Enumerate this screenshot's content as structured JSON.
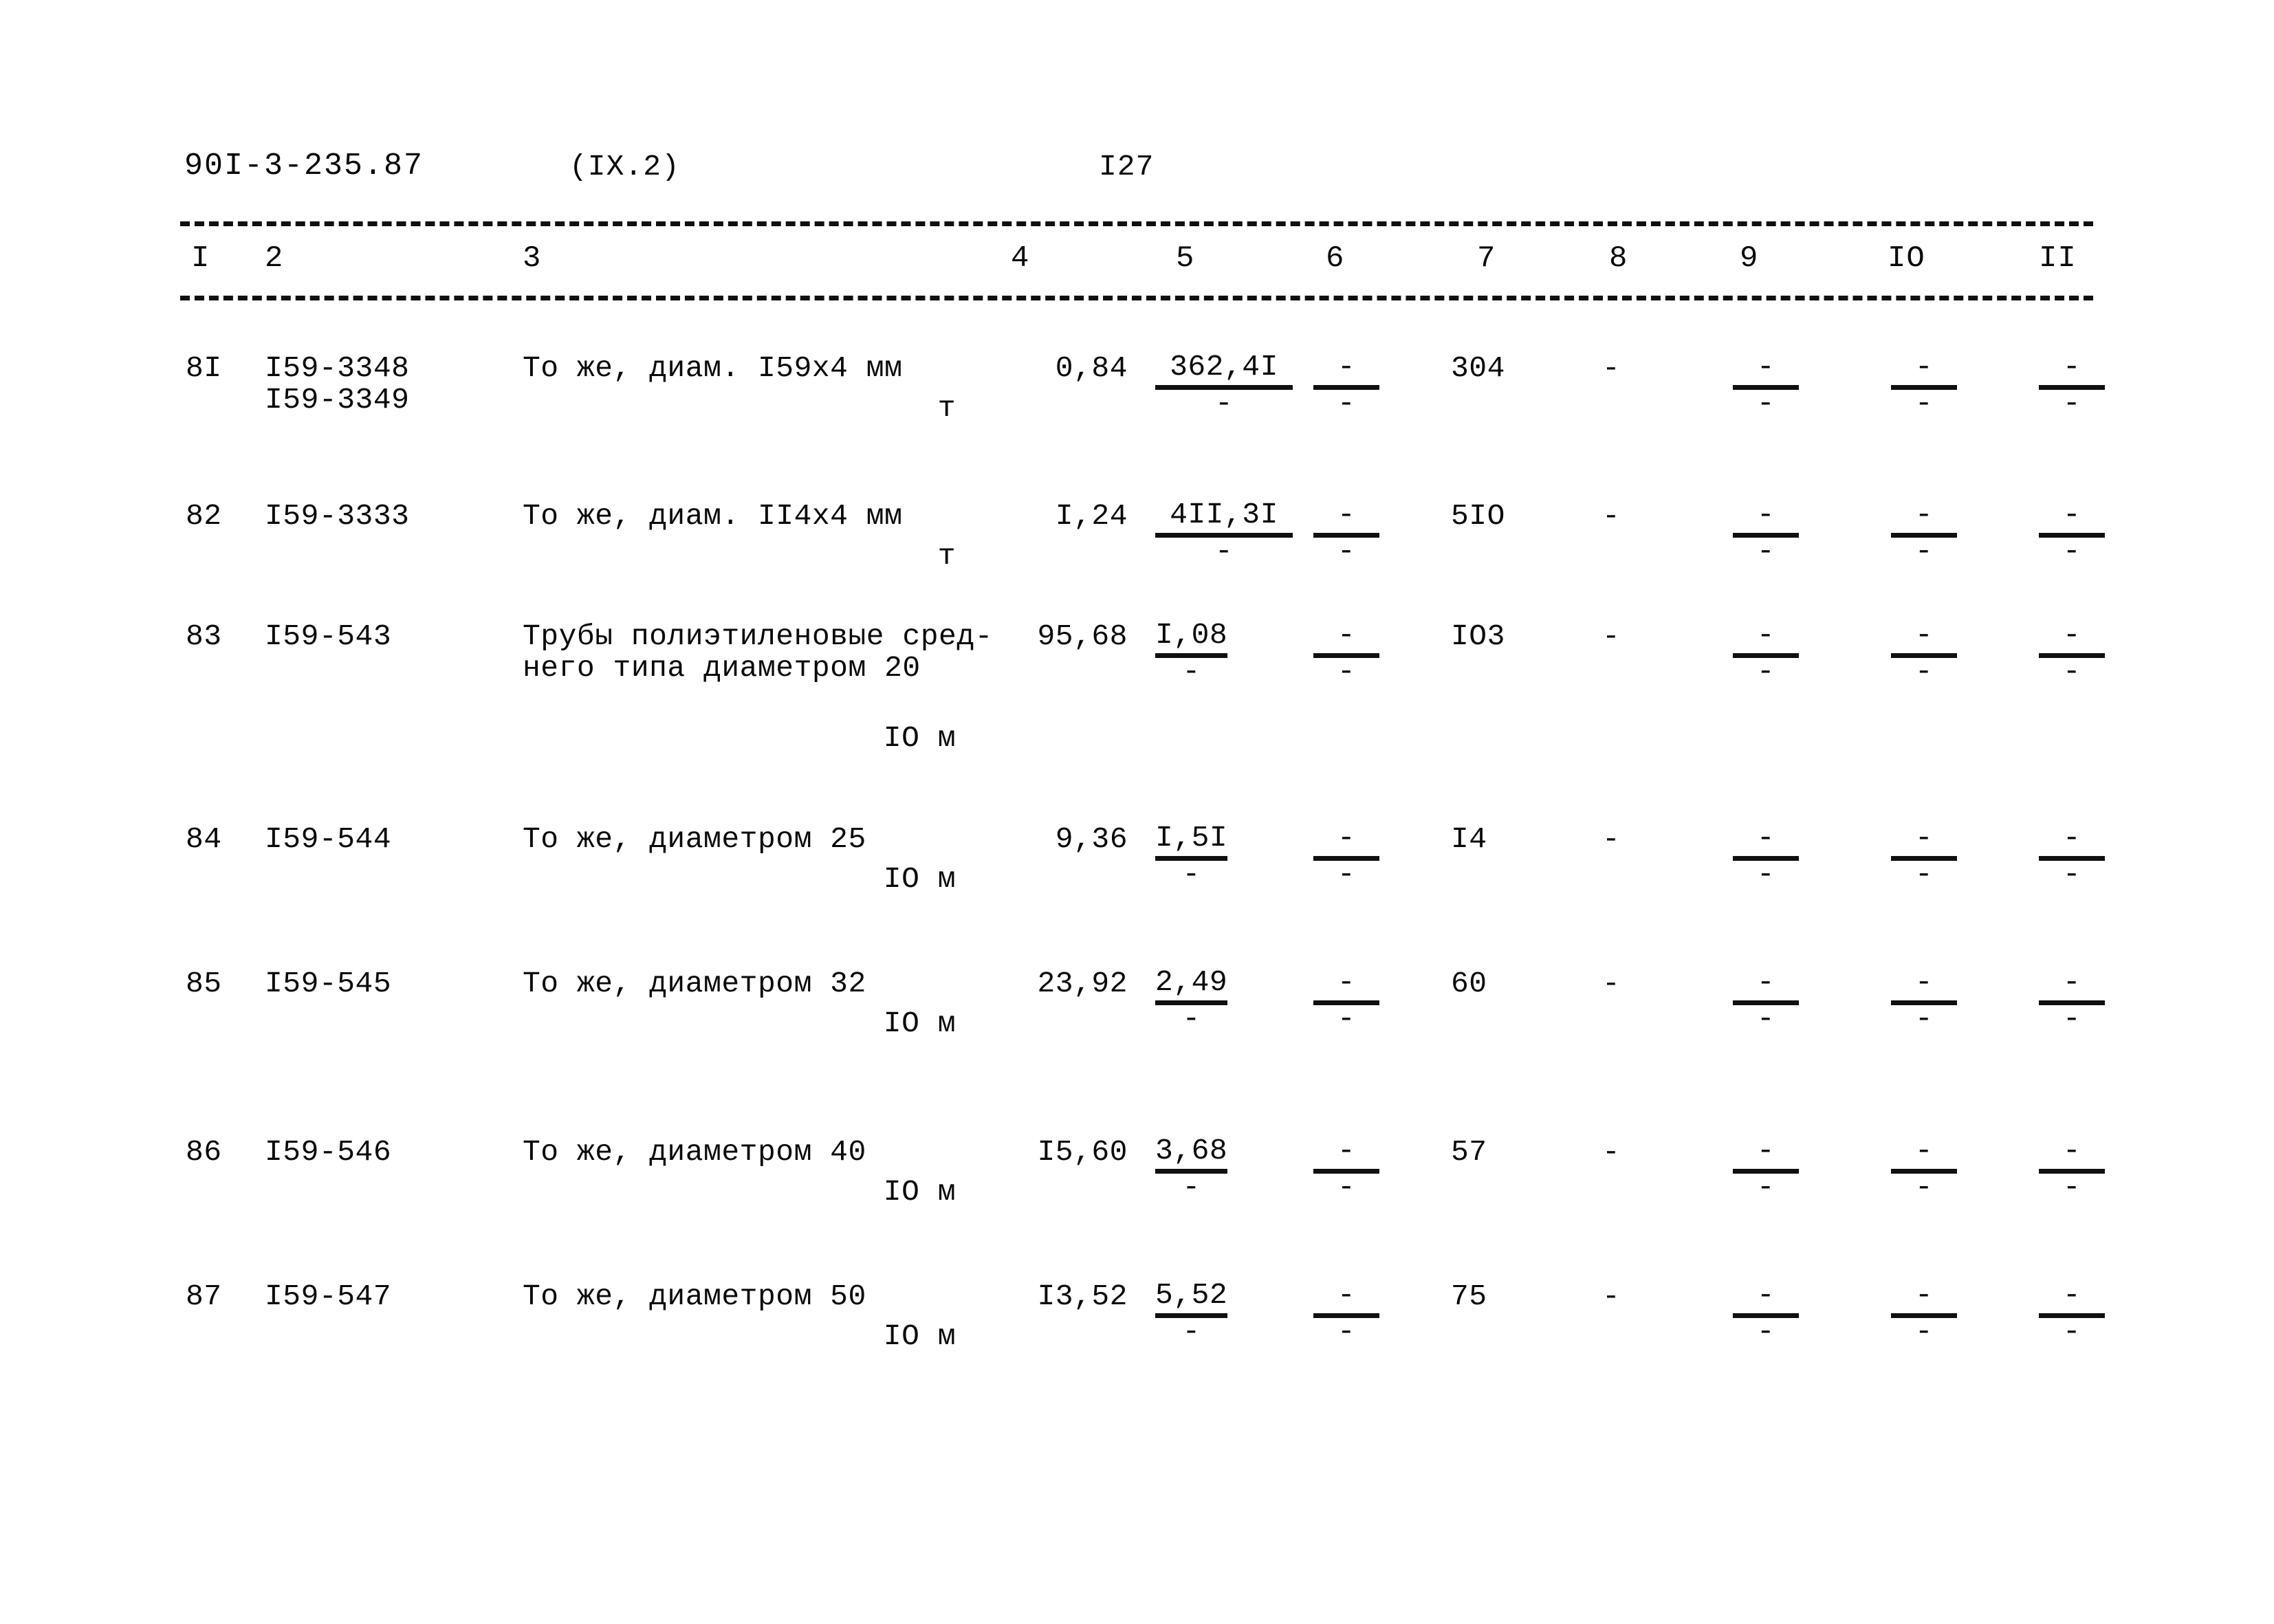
{
  "header": {
    "document_code": "90I-3-235.87",
    "section": "(IX.2)",
    "page_number": "I27"
  },
  "table": {
    "column_headers": [
      "I",
      "2",
      "3",
      "4",
      "5",
      "6",
      "7",
      "8",
      "9",
      "IO",
      "II"
    ],
    "rows": [
      {
        "num": "8I",
        "code": "I59-3348",
        "code2": "I59-3349",
        "desc_line1": "То же, диам. I59x4 мм",
        "desc_line2": "",
        "unit": "т",
        "col4": "0,84",
        "col5_num": "362,4I",
        "col5_den": "-",
        "col6_num": "-",
        "col6_den": "-",
        "col7": "304",
        "col8": "-",
        "col9_num": "-",
        "col9_den": "-",
        "col10_num": "-",
        "col10_den": "-",
        "col11_num": "-",
        "col11_den": "-"
      },
      {
        "num": "82",
        "code": "I59-3333",
        "code2": "",
        "desc_line1": "То же, диам. II4x4 мм",
        "desc_line2": "",
        "unit": "т",
        "col4": "I,24",
        "col5_num": "4II,3I",
        "col5_den": "-",
        "col6_num": "-",
        "col6_den": "-",
        "col7": "5IO",
        "col8": "-",
        "col9_num": "-",
        "col9_den": "-",
        "col10_num": "-",
        "col10_den": "-",
        "col11_num": "-",
        "col11_den": "-"
      },
      {
        "num": "83",
        "code": "I59-543",
        "code2": "",
        "desc_line1": "Трубы полиэтиленовые сред-",
        "desc_line2": "него типа диаметром 20",
        "unit": "IO м",
        "col4": "95,68",
        "col5_num": "I,08",
        "col5_den": "-",
        "col6_num": "-",
        "col6_den": "-",
        "col7": "IO3",
        "col8": "-",
        "col9_num": "-",
        "col9_den": "-",
        "col10_num": "-",
        "col10_den": "-",
        "col11_num": "-",
        "col11_den": "-"
      },
      {
        "num": "84",
        "code": "I59-544",
        "code2": "",
        "desc_line1": "То же, диаметром 25",
        "desc_line2": "",
        "unit": "IO м",
        "col4": "9,36",
        "col5_num": "I,5I",
        "col5_den": "-",
        "col6_num": "-",
        "col6_den": "-",
        "col7": "I4",
        "col8": "-",
        "col9_num": "-",
        "col9_den": "-",
        "col10_num": "-",
        "col10_den": "-",
        "col11_num": "-",
        "col11_den": "-"
      },
      {
        "num": "85",
        "code": "I59-545",
        "code2": "",
        "desc_line1": "То же, диаметром 32",
        "desc_line2": "",
        "unit": "IO м",
        "col4": "23,92",
        "col5_num": "2,49",
        "col5_den": "-",
        "col6_num": "-",
        "col6_den": "-",
        "col7": "60",
        "col8": "-",
        "col9_num": "-",
        "col9_den": "-",
        "col10_num": "-",
        "col10_den": "-",
        "col11_num": "-",
        "col11_den": "-"
      },
      {
        "num": "86",
        "code": "I59-546",
        "code2": "",
        "desc_line1": "То же, диаметром 40",
        "desc_line2": "",
        "unit": "IO м",
        "col4": "I5,60",
        "col5_num": "3,68",
        "col5_den": "-",
        "col6_num": "-",
        "col6_den": "-",
        "col7": "57",
        "col8": "-",
        "col9_num": "-",
        "col9_den": "-",
        "col10_num": "-",
        "col10_den": "-",
        "col11_num": "-",
        "col11_den": "-"
      },
      {
        "num": "87",
        "code": "I59-547",
        "code2": "",
        "desc_line1": "То же, диаметром 50",
        "desc_line2": "",
        "unit": "IO м",
        "col4": "I3,52",
        "col5_num": "5,52",
        "col5_den": "-",
        "col6_num": "-",
        "col6_den": "-",
        "col7": "75",
        "col8": "-",
        "col9_num": "-",
        "col9_den": "-",
        "col10_num": "-",
        "col10_den": "-",
        "col11_num": "-",
        "col11_den": "-"
      }
    ]
  }
}
